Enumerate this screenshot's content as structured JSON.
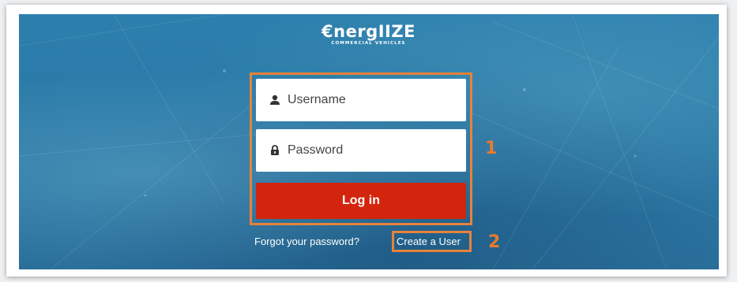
{
  "logo": {
    "name": "€nergIIZE",
    "tagline": "COMMERCIAL VEHICLES"
  },
  "login_form": {
    "username_placeholder": "Username",
    "password_placeholder": "Password",
    "login_label": "Log in"
  },
  "links": {
    "forgot_password": "Forgot your password?",
    "create_user": "Create a User"
  },
  "annotations": {
    "callout_1": "1",
    "callout_2": "2"
  },
  "colors": {
    "background": "#2a78a6",
    "login_button": "#d3250d",
    "annotation": "#e8823a"
  },
  "icons": {
    "username": "user-icon",
    "password": "lock-icon"
  }
}
